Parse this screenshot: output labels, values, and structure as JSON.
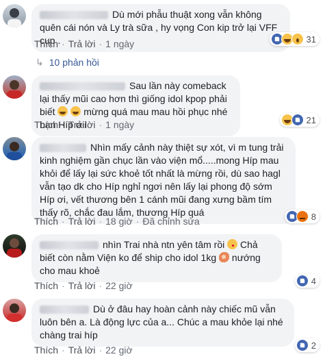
{
  "actions": {
    "like": "Thích",
    "reply": "Trả lời",
    "separator": "·"
  },
  "comments": [
    {
      "text": "Dù mới phẫu thuật xong vẫn không quên cái nón và Ly trà sữa , hy vọng Con kip trở lại VFF cup .",
      "time": "1 ngày",
      "edited": "",
      "reaction_count": "31",
      "reactions": [
        "like-icon",
        "haha-icon",
        "wow-icon"
      ],
      "replies": "10 phản hồi"
    },
    {
      "text_before": "Sau lần này comeback lại thấy mũi cao hơn thì giống idol kpop phải biết ",
      "text_after": " mừng quá mau mau hồi phục nhé bạn Híp ơii",
      "time": "1 ngày",
      "reaction_count": "21",
      "reactions": [
        "haha-icon",
        "like-icon"
      ]
    },
    {
      "text": "Nhìn mấy cảnh này thiệt sự xót, vì m tung trải kinh nghiệm gần chục lần vào viện mổ.....mong Híp mau khỏi để lấy lại sức khoẻ tốt nhất là mừng rồi, dù sao hagl vẫn tạo dk cho Híp nghỉ ngơi nên lấy lại phong độ sớm Híp ơi, vết thương bên 1 cánh mũi đang xưng bầm tím thấy rõ, chắc đau lắm, thương Híp quá",
      "time": "18 giờ",
      "edited": "Đã chỉnh sửa",
      "reaction_count": "8",
      "reactions": [
        "like-icon",
        "angry-icon"
      ]
    },
    {
      "text_a": "nhìn Trai nhà ntn yên tâm rồi ",
      "text_b": " Chả biết còn nằm Viện ko để ship cho idol 1kg ",
      "text_c": " nướng cho mau khoẻ",
      "time": "22 giờ",
      "reaction_count": "4",
      "reactions": [
        "like-icon"
      ]
    },
    {
      "text": "Dù ở đâu hay hoàn cảnh này chiếc mũ vẫn luôn bên a. Là động lực của a... Chúc a mau khỏe lại nhé chàng trai híp",
      "time": "22 giờ",
      "reaction_count": "2",
      "reactions": [
        "like-icon"
      ]
    }
  ],
  "colors": {
    "bubble": "#f2f3f5",
    "like_blue": "#4267b2",
    "link": "#385898",
    "meta": "#90949c"
  }
}
